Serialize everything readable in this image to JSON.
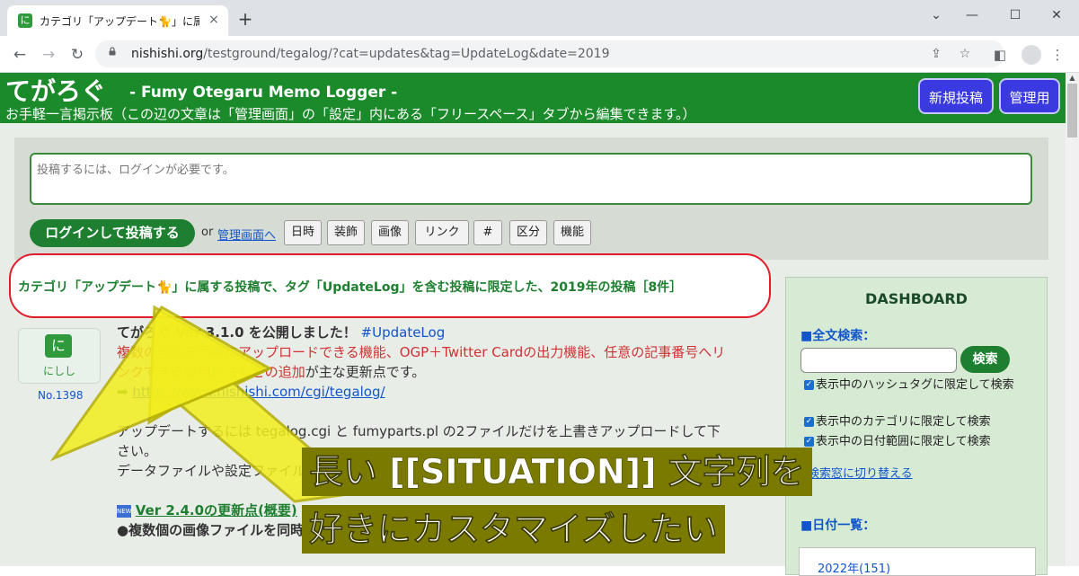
{
  "browser": {
    "tab_title": "カテゴリ「アップデート🐈」に属する投稿",
    "tab_close": "×",
    "new_tab": "+",
    "url_host": "nishishi.org",
    "url_path": "/testground/tegalog/?cat=updates&tag=UpdateLog&date=2019",
    "win_min": "—",
    "win_max": "☐",
    "win_close": "✕",
    "tab_menu": "⌄"
  },
  "site": {
    "title": "てがろぐ",
    "subtitle": "- Fumy Otegaru Memo Logger -",
    "description": "お手軽一言掲示板（この辺の文章は「管理画面」の「設定」内にある「フリースペース」タブから編集できます。）",
    "new_post_button": "新規投稿",
    "admin_button": "管理用"
  },
  "post_form": {
    "placeholder": "投稿するには、ログインが必要です。",
    "login_button": "ログインして投稿する",
    "or_text": "or",
    "admin_link": "管理画面へ",
    "tools": [
      "日時",
      "装飾",
      "画像",
      "リンク",
      "#",
      "区分",
      "機能"
    ]
  },
  "situation": {
    "text": "カテゴリ「アップデート🐈」に属する投稿で、タグ「UpdateLog」を含む投稿に限定した、2019年の投稿［8件］"
  },
  "post": {
    "avatar_name": "にしし",
    "number": "No.1398",
    "line1_title": "てがろぐ Ver 3.1.0 を公開しました！",
    "line1_tag": "#UpdateLog",
    "line2": "複数の画像を同時にアップロードできる機能、OGP＋Twitter Cardの出力機能、任意の記事番号へリ",
    "line3a": "ンクできる専用記法などの追加",
    "line3b": "が主な更新点です。",
    "link": "https://www.nishishi.com/cgi/tegalog/",
    "line5": "アップデートするには tegalog.cgi と fumyparts.pl の2ファイルだけを上書きアップロードして下",
    "line6": "さい。",
    "line7": "データファイルや設定ファイルはすべてそのまま継承されます。(過去のこのシステムでも)",
    "line8": "Ver 2.4.0の更新点(概要)",
    "line9": "●複数個の画像ファイルを同時にアップロード(投稿)可能になりました。",
    "new_badge": "NEW"
  },
  "sidebar": {
    "title": "DASHBOARD",
    "search_label": "■全文検索：",
    "search_button": "検索",
    "check1": "表示中のハッシュタグに限定して検索",
    "check2": "表示中のカテゴリに限定して検索",
    "check3": "表示中の日付範囲に限定して検索",
    "switch_link": "検索窓に切り替える",
    "date_label": "■日付一覧：",
    "date_item": "2022年(151)"
  },
  "callout": {
    "line1": "長い [[SITUATION]] 文字列を",
    "line2": "好きにカスタマイズしたい"
  },
  "colors": {
    "header_green": "#1a8a2a",
    "situation_border": "#e11d2d",
    "arrow_yellow": "#f2ee1d"
  }
}
